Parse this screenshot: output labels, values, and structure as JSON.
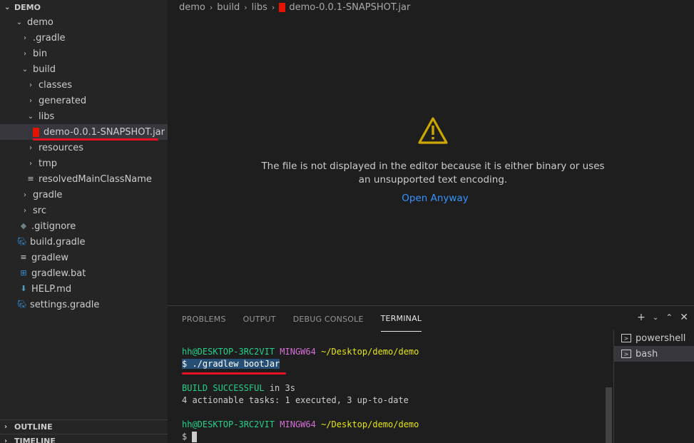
{
  "explorer": {
    "section_title": "DEMO",
    "tree": [
      {
        "label": "demo",
        "depth": 1,
        "kind": "folder-open"
      },
      {
        "label": ".gradle",
        "depth": 2,
        "kind": "folder"
      },
      {
        "label": "bin",
        "depth": 2,
        "kind": "folder"
      },
      {
        "label": "build",
        "depth": 2,
        "kind": "folder-open"
      },
      {
        "label": "classes",
        "depth": 3,
        "kind": "folder"
      },
      {
        "label": "generated",
        "depth": 3,
        "kind": "folder"
      },
      {
        "label": "libs",
        "depth": 3,
        "kind": "folder-open"
      },
      {
        "label": "demo-0.0.1-SNAPSHOT.jar",
        "depth": 4,
        "kind": "jar"
      },
      {
        "label": "resources",
        "depth": 3,
        "kind": "folder"
      },
      {
        "label": "tmp",
        "depth": 3,
        "kind": "folder"
      },
      {
        "label": "resolvedMainClassName",
        "depth": 3,
        "kind": "text-file"
      },
      {
        "label": "gradle",
        "depth": 2,
        "kind": "folder"
      },
      {
        "label": "src",
        "depth": 2,
        "kind": "folder"
      },
      {
        "label": ".gitignore",
        "depth": 2,
        "kind": "git-file"
      },
      {
        "label": "build.gradle",
        "depth": 2,
        "kind": "gradle-file"
      },
      {
        "label": "gradlew",
        "depth": 2,
        "kind": "text-file"
      },
      {
        "label": "gradlew.bat",
        "depth": 2,
        "kind": "windows-file"
      },
      {
        "label": "HELP.md",
        "depth": 2,
        "kind": "markdown-file"
      },
      {
        "label": "settings.gradle",
        "depth": 2,
        "kind": "gradle-file"
      }
    ],
    "outline_title": "OUTLINE",
    "timeline_title": "TIMELINE"
  },
  "editor": {
    "breadcrumb": [
      "demo",
      "build",
      "libs",
      "demo-0.0.1-SNAPSHOT.jar"
    ],
    "message_line1": "The file is not displayed in the editor because it is either binary or uses",
    "message_line2": "an unsupported text encoding.",
    "open_anyway": "Open Anyway"
  },
  "panel": {
    "tabs": [
      "PROBLEMS",
      "OUTPUT",
      "DEBUG CONSOLE",
      "TERMINAL"
    ],
    "active_tab": "TERMINAL",
    "terminal": {
      "user_host": "hh@DESKTOP-3RC2VIT",
      "shell": "MINGW64",
      "cwd": "~/Desktop/demo/demo",
      "command": "$ ./gradlew bootJar",
      "build_status": "BUILD SUCCESSFUL",
      "build_time": " in 3s",
      "tasks_line": "4 actionable tasks: 1 executed, 3 up-to-date",
      "prompt": "$ "
    },
    "terminals": [
      "powershell",
      "bash"
    ],
    "active_terminal": "bash"
  },
  "colors": {
    "selection_red_underline": "#e81123",
    "link_blue": "#3794ff",
    "warning_yellow": "#cca700",
    "terminal_green": "#23d18b",
    "terminal_magenta": "#d670d6",
    "terminal_yellow": "#e5e510"
  }
}
